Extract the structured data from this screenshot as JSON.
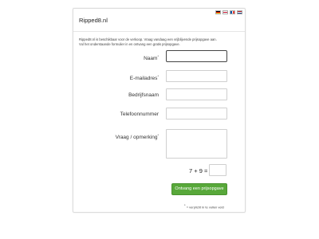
{
  "header": {
    "title": "Ripped8.nl",
    "flags": [
      "de",
      "gb",
      "fr",
      "nl"
    ]
  },
  "intro": {
    "line1": "Ripped8.nl is beschikbaar voor de verkoop. Vraag vandaag een vrijblijvende prijsopgave aan.",
    "line2": "Vul het onderstaande formulier in en ontvang een gratis prijsopgave."
  },
  "form": {
    "name_label": "Naam",
    "email_label": "E-mailadres",
    "company_label": "Bedrijfsnaam",
    "phone_label": "Telefoonnummer",
    "question_label": "Vraag / opmerking",
    "required_mark": "*",
    "captcha_question": "7 + 9 =",
    "submit_label": "Ontvang een prijsopgave",
    "footnote": "= verplicht in te vullen veld"
  },
  "colors": {
    "submit": "#58a83a",
    "active_border": "#444444"
  }
}
